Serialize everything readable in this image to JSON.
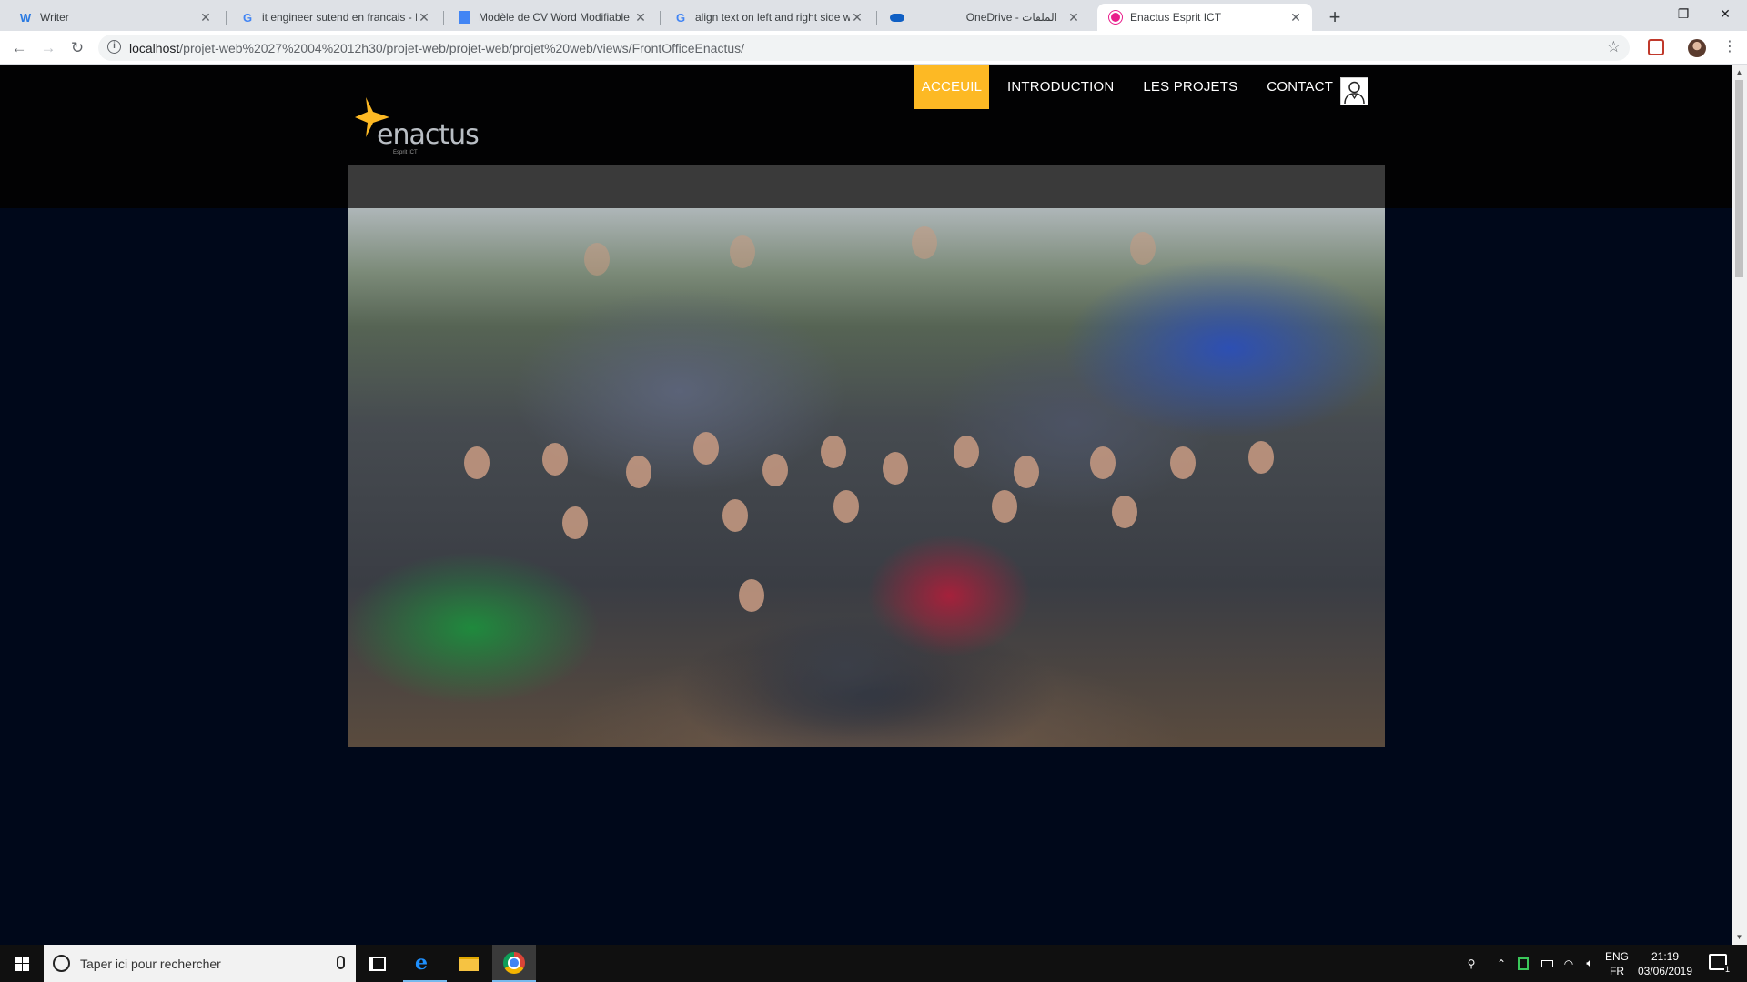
{
  "browser": {
    "tabs": [
      {
        "title": "Writer",
        "icon": "writer-icon",
        "active": false
      },
      {
        "title": "it engineer sutend en francais - R",
        "icon": "google-icon",
        "active": false
      },
      {
        "title": "Modèle de CV Word Modifiable (",
        "icon": "docs-icon",
        "active": false
      },
      {
        "title": "align text on left and right side w",
        "icon": "google-icon",
        "active": false
      },
      {
        "title": "OneDrive - الملفات",
        "icon": "onedrive-icon",
        "active": false
      },
      {
        "title": "Enactus Esprit ICT",
        "icon": "enactus-icon",
        "active": true
      }
    ],
    "url_host": "localhost",
    "url_path": "/projet-web%2027%2004%2012h30/projet-web/projet-web/projet%20web/views/FrontOfficeEnactus/"
  },
  "site": {
    "logo_text": "enactus",
    "logo_sub": "Esprit ICT",
    "nav": [
      {
        "label": "ACCEUIL",
        "active": true
      },
      {
        "label": "INTRODUCTION",
        "active": false
      },
      {
        "label": "LES PROJETS",
        "active": false
      },
      {
        "label": "CONTACT",
        "active": false
      }
    ],
    "accent_color": "#fdb924",
    "background_color": "#00081a"
  },
  "taskbar": {
    "search_placeholder": "Taper ici pour rechercher",
    "lang_line1": "ENG",
    "lang_line2": "FR",
    "time": "21:19",
    "date": "03/06/2019",
    "notification_count": "1"
  }
}
